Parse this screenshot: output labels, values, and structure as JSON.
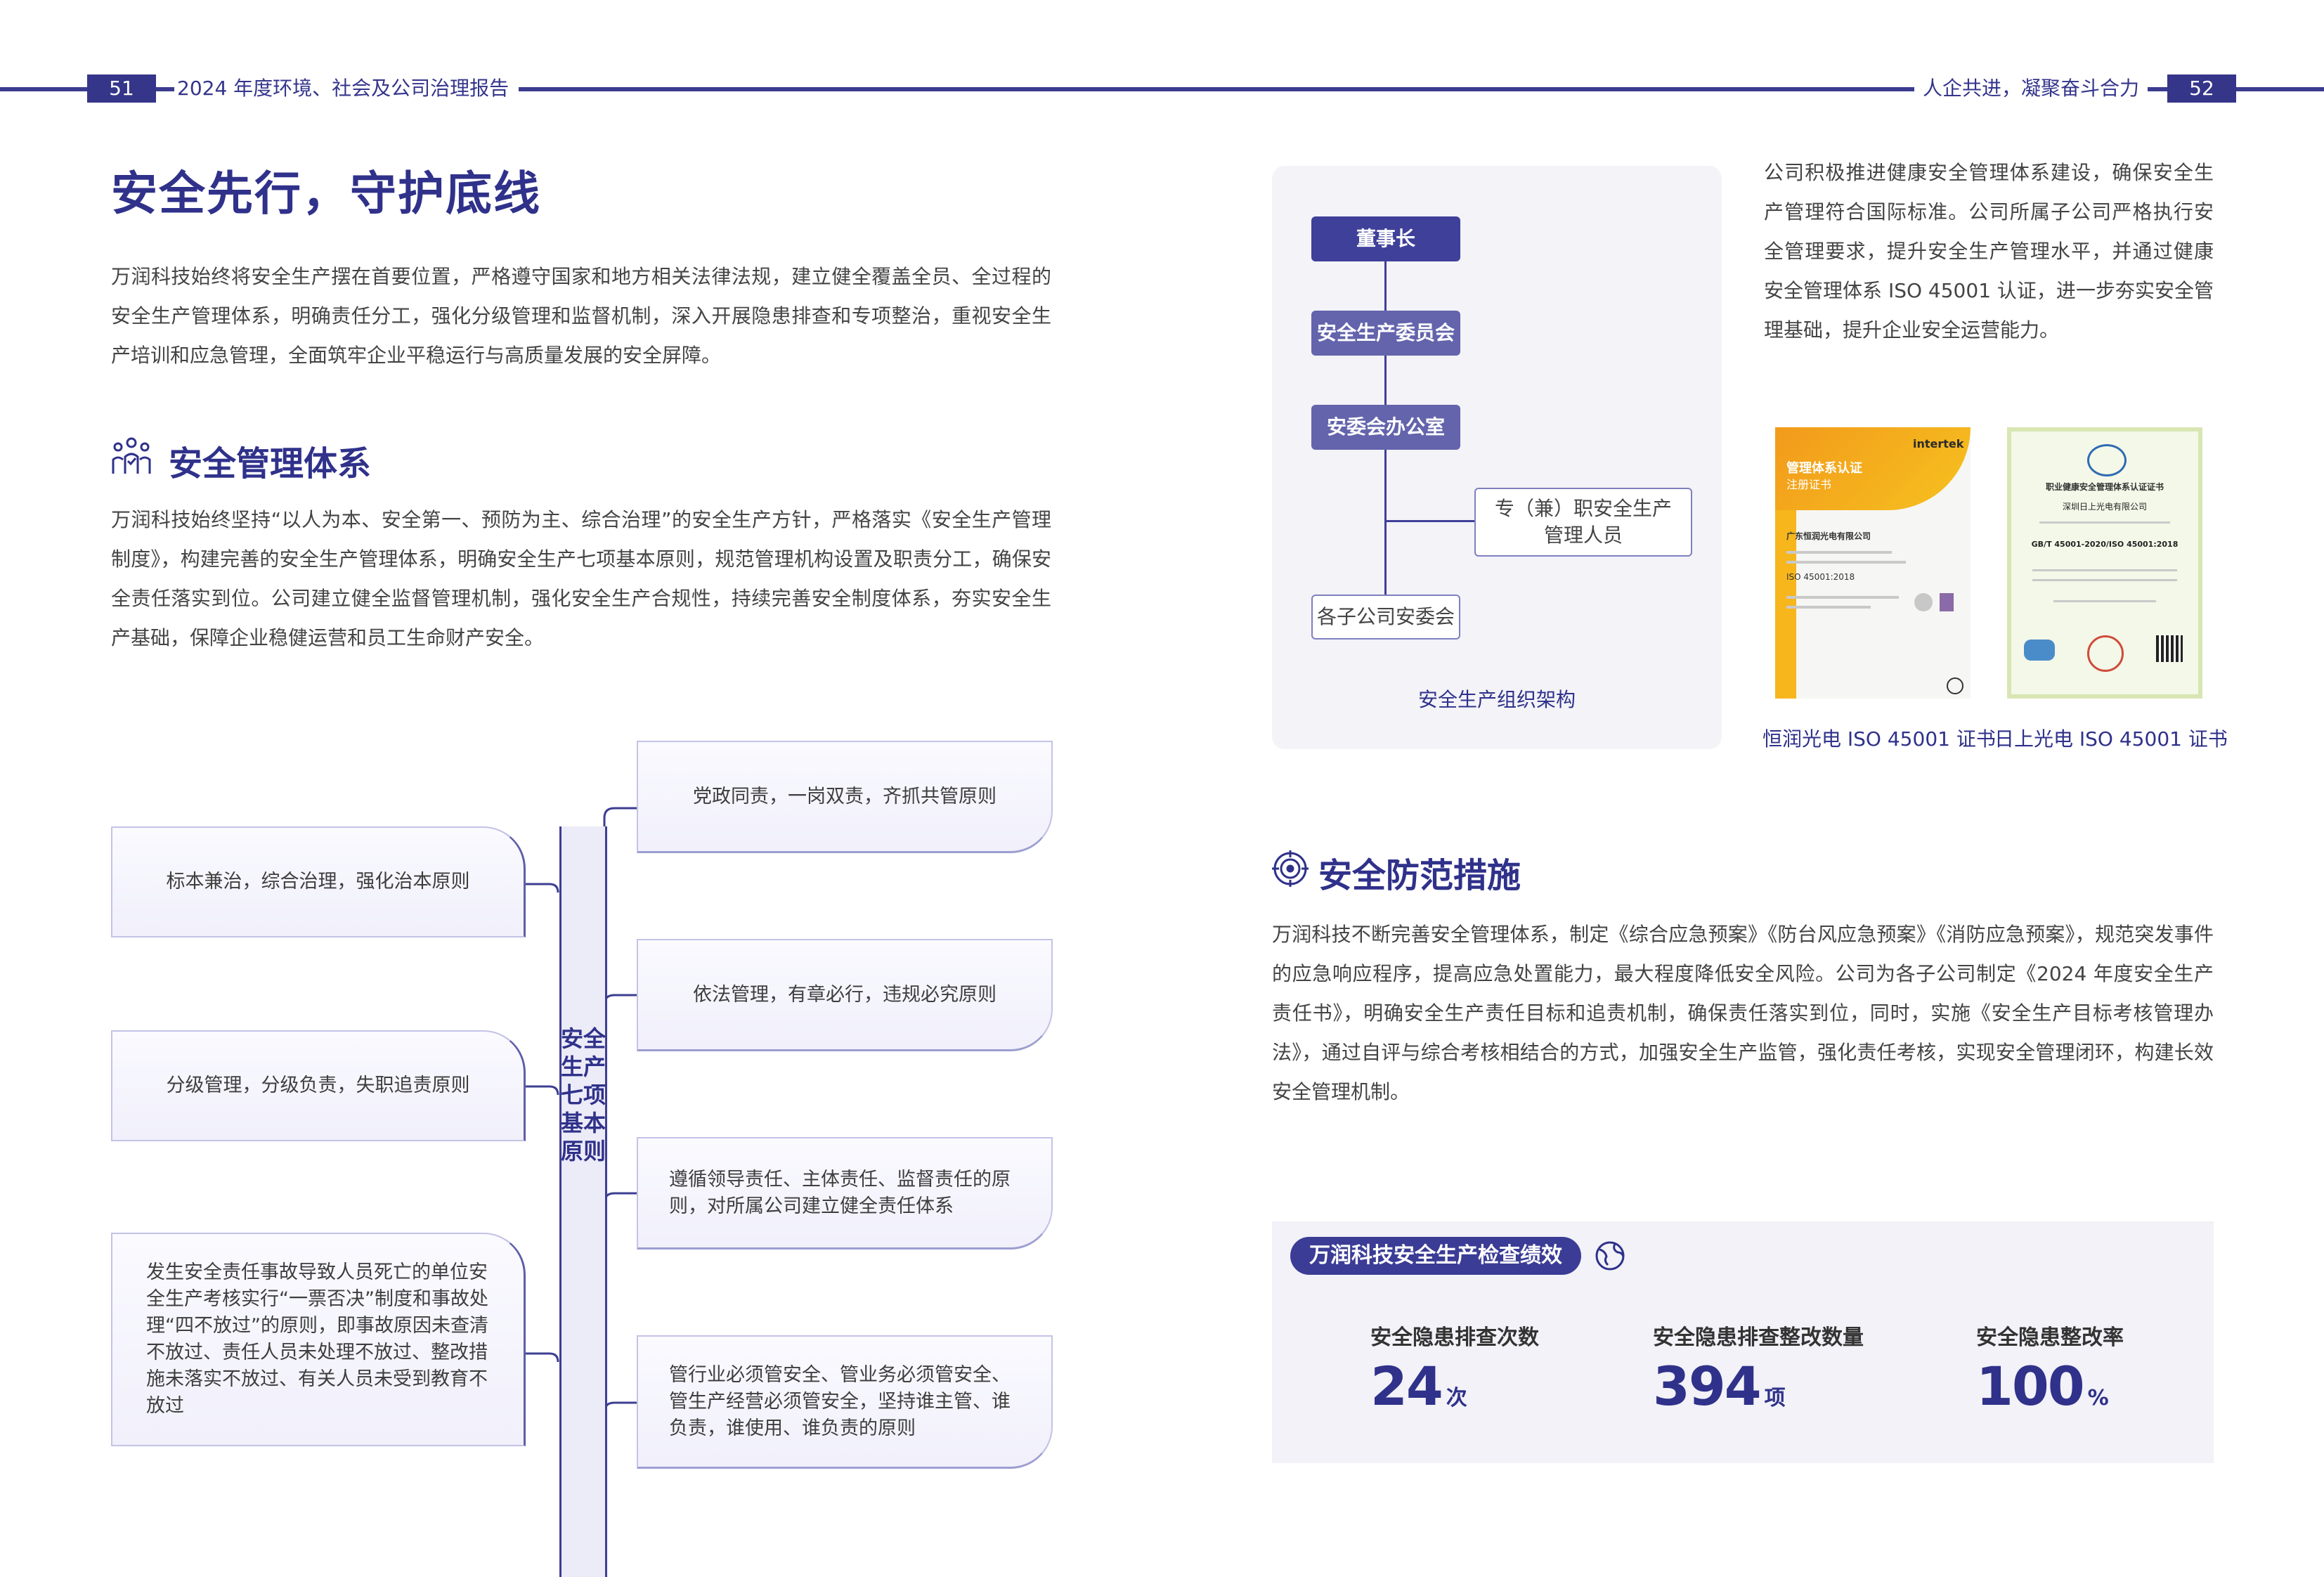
{
  "header": {
    "left_page": "51",
    "left_title": "2024 年度环境、社会及公司治理报告",
    "right_title": "人企共进，凝聚奋斗合力",
    "right_page": "52"
  },
  "main_title": "安全先行，守护底线",
  "intro": "万润科技始终将安全生产摆在首要位置，严格遵守国家和地方相关法律法规，建立健全覆盖全员、全过程的安全生产管理体系，明确责任分工，强化分级管理和监督机制，深入开展隐患排查和专项整治，重视安全生产培训和应急管理，全面筑牢企业平稳运行与高质量发展的安全屏障。",
  "section1": {
    "title": "安全管理体系",
    "body": "万润科技始终坚持“以人为本、安全第一、预防为主、综合治理”的安全生产方针，严格落实《安全生产管理制度》，构建完善的安全生产管理体系，明确安全生产七项基本原则，规范管理机构设置及职责分工，确保安全责任落实到位。公司建立健全监督管理机制，强化安全生产合规性，持续完善安全制度体系，夯实安全生产基础，保障企业稳健运营和员工生命财产安全。"
  },
  "principles": {
    "center_label": "安全生产七项基本原则",
    "right": [
      "党政同责，一岗双责，齐抓共管原则",
      "依法管理，有章必行，违规必究原则",
      "遵循领导责任、主体责任、监督责任的原则，对所属公司建立健全责任体系",
      "管行业必须管安全、管业务必须管安全、管生产经营必须管安全，坚持谁主管、谁负责，谁使用、谁负责的原则"
    ],
    "left": [
      "标本兼治，综合治理，强化治本原则",
      "分级管理，分级负责，失职追责原则",
      "发生安全责任事故导致人员死亡的单位安全生产考核实行“一票否决”制度和事故处理“四不放过”的原则，即事故原因未查清不放过、责任人员未处理不放过、整改措施未落实不放过、有关人员未受到教育不放过"
    ]
  },
  "org_chart": {
    "nodes": [
      "董事长",
      "安全生产委员会",
      "安委会办公室",
      "专（兼）职安全生产管理人员",
      "各子公司安委会"
    ],
    "caption": "安全生产组织架构"
  },
  "iso_text": "公司积极推进健康安全管理体系建设，确保安全生产管理符合国际标准。公司所属子公司严格执行安全管理要求，提升安全生产管理水平，并通过健康安全管理体系 ISO 45001 认证，进一步夯实安全管理基础，提升企业安全运营能力。",
  "certificates": [
    {
      "caption": "恒润光电 ISO 45001 证书",
      "title": "管理体系认证",
      "subtitle": "注册证书",
      "brand": "intertek",
      "company": "广东恒润光电有限公司",
      "standard": "ISO 45001:2018"
    },
    {
      "caption": "日上光电 ISO 45001 证书",
      "title": "职业健康安全管理体系认证证书",
      "company": "深圳日上光电有限公司",
      "standard": "GB/T 45001-2020/ISO 45001:2018"
    }
  ],
  "section2": {
    "title": "安全防范措施",
    "body": "万润科技不断完善安全管理体系，制定《综合应急预案》《防台风应急预案》《消防应急预案》，规范突发事件的应急响应程序，提高应急处置能力，最大程度降低安全风险。公司为各子公司制定《2024 年度安全生产责任书》，明确安全生产责任目标和追责机制，确保责任落实到位，同时，实施《安全生产目标考核管理办法》，通过自评与综合考核相结合的方式，加强安全生产监管，强化责任考核，实现安全管理闭环，构建长效安全管理机制。"
  },
  "stats": {
    "title": "万润科技安全生产检查绩效",
    "items": [
      {
        "label": "安全隐患排查次数",
        "value": "24",
        "unit": "次"
      },
      {
        "label": "安全隐患排查整改数量",
        "value": "394",
        "unit": "项"
      },
      {
        "label": "安全隐患整改率",
        "value": "100",
        "unit": "%"
      }
    ]
  },
  "colors": {
    "brand": "#2f318a",
    "panel": "#f2f2f8",
    "accent_orange": "#f29a1b"
  }
}
